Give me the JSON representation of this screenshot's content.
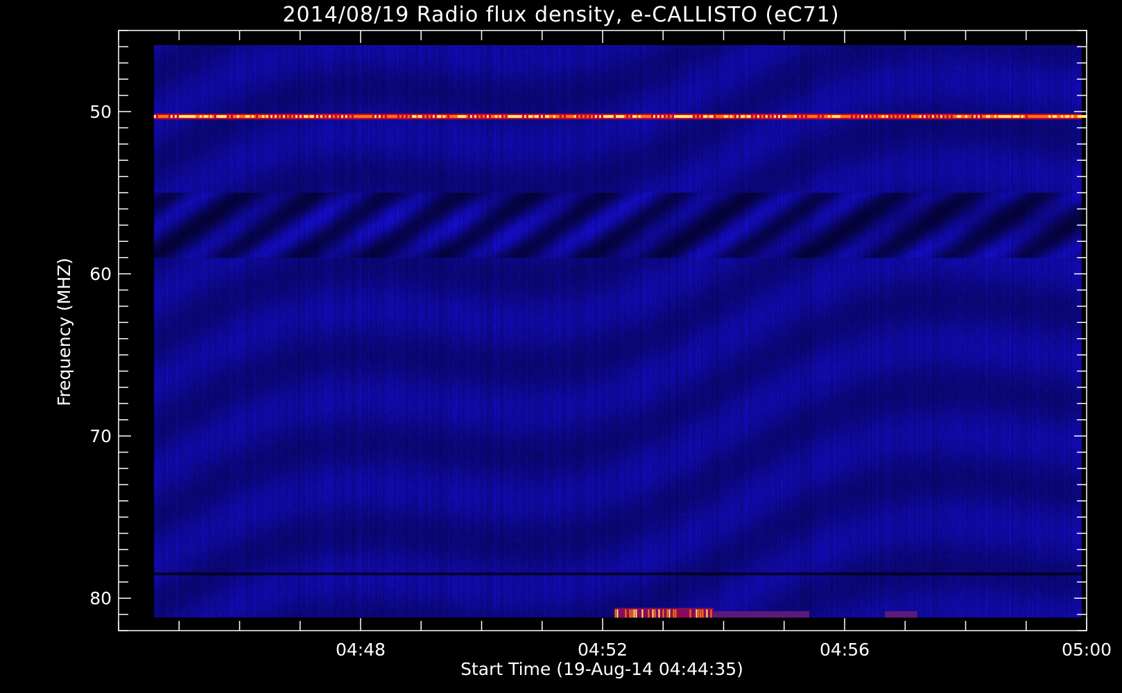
{
  "chart_data": {
    "type": "heatmap",
    "title": "2014/08/19  Radio flux density, e-CALLISTO (eC71)",
    "xlabel": "Start Time (19-Aug-14 04:44:35)",
    "ylabel": "Frequency (MHZ)",
    "x_start": "04:44:35",
    "x_axis_range": [
      "04:44:00",
      "05:00:00"
    ],
    "data_range": [
      "04:44:35",
      "04:59:55"
    ],
    "x_ticks": [
      "04:48",
      "04:52",
      "04:56",
      "05:00"
    ],
    "y_axis_range": [
      45,
      82
    ],
    "data_freq_range": [
      45.9,
      81.2
    ],
    "y_ticks": [
      50,
      60,
      70,
      80
    ],
    "y_inverted": true,
    "colormap": [
      "#000000",
      "#1a1ab3",
      "#3333ff",
      "#cc0033",
      "#ff7700",
      "#ffee66"
    ],
    "background_color": "#000000",
    "features": [
      {
        "kind": "narrowband_interference_line",
        "freq_mhz": 50.3
      },
      {
        "kind": "dark_band_line",
        "freq_mhz": 78.5
      },
      {
        "kind": "bright_patch",
        "start": "04:52:12",
        "end": "04:53:50",
        "freq_mhz": [
          80.6,
          81.2
        ]
      },
      {
        "kind": "weak_patch",
        "start": "04:53:50",
        "end": "04:55:25",
        "freq_mhz": [
          80.8,
          81.2
        ]
      },
      {
        "kind": "weak_patch",
        "start": "04:56:40",
        "end": "04:57:12",
        "freq_mhz": [
          80.8,
          81.2
        ]
      }
    ]
  }
}
